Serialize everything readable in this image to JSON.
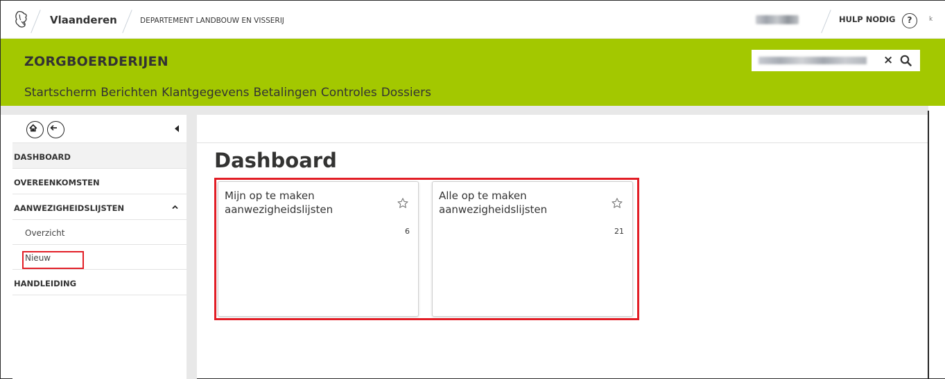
{
  "header": {
    "site_name": "Vlaanderen",
    "department": "DEPARTEMENT LANDBOUW EN VISSERIJ",
    "help_label": "HULP NODIG",
    "help_icon_text": "?",
    "stray_char": "k"
  },
  "app": {
    "title": "ZORGBOERDERIJEN",
    "search_clear": "×",
    "nav": [
      "Startscherm",
      "Berichten",
      "Klantgegevens",
      "Betalingen",
      "Controles",
      "Dossiers"
    ]
  },
  "sidebar": {
    "items": [
      {
        "label": "DASHBOARD"
      },
      {
        "label": "OVEREENKOMSTEN"
      },
      {
        "label": "AANWEZIGHEIDSLIJSTEN"
      }
    ],
    "subitems": [
      {
        "label": "Overzicht"
      },
      {
        "label": "Nieuw"
      }
    ],
    "last_item": {
      "label": "HANDLEIDING"
    }
  },
  "main": {
    "title": "Dashboard",
    "cards": [
      {
        "title": "Mijn op te maken aanwezigheidslijsten",
        "count": "6"
      },
      {
        "title": "Alle op te maken aanwezigheidslijsten",
        "count": "21"
      }
    ]
  },
  "colors": {
    "brand_green": "#a3c800",
    "highlight_red": "#e21d25"
  }
}
